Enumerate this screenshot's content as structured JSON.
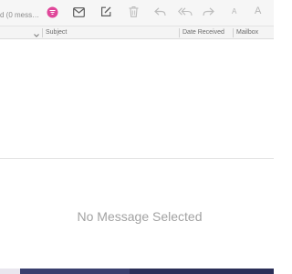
{
  "window": {
    "subtitle": "d (0 messa..."
  },
  "toolbar": {
    "icons": [
      {
        "name": "filter-icon",
        "color": "#e0479a"
      },
      {
        "name": "get-mail-icon"
      },
      {
        "name": "compose-icon"
      },
      {
        "name": "trash-icon"
      },
      {
        "name": "reply-icon"
      },
      {
        "name": "reply-all-icon"
      },
      {
        "name": "forward-icon"
      },
      {
        "name": "text-smaller-icon",
        "label": "A"
      },
      {
        "name": "text-larger-icon",
        "label": "A"
      }
    ]
  },
  "columns": {
    "subject": "Subject",
    "date_received": "Date Received",
    "mailbox": "Mailbox"
  },
  "preview": {
    "empty_text": "No Message Selected"
  },
  "colors": {
    "accent": "#e0479a",
    "icon_active": "#5c5c5c",
    "icon_disabled": "#bdbdbd"
  }
}
